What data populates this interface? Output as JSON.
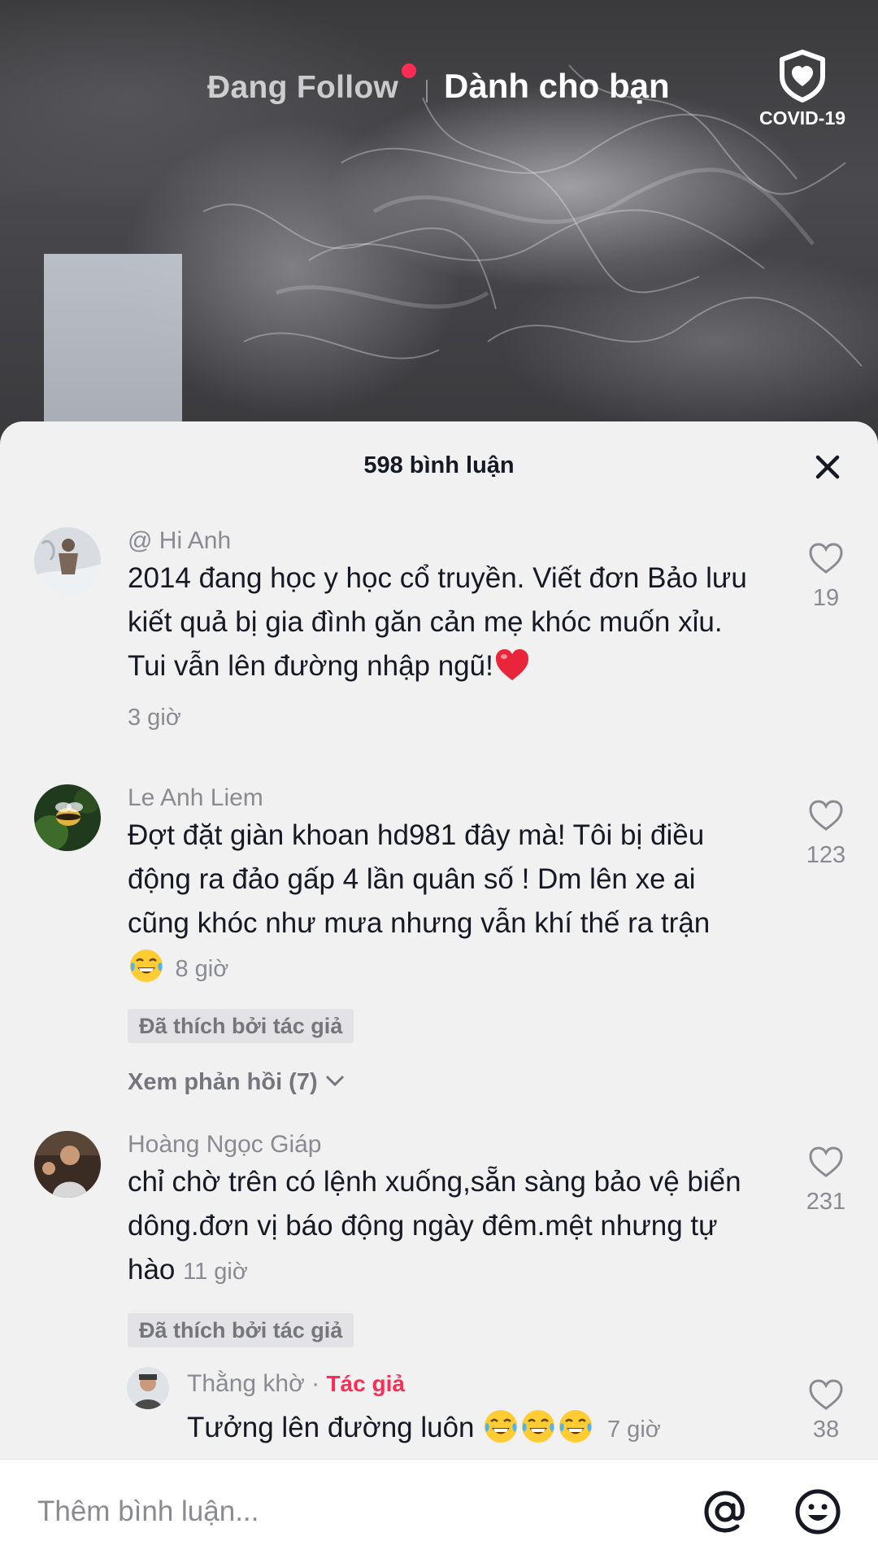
{
  "top_nav": {
    "following_label": "Đang Follow",
    "for_you_label": "Dành cho bạn",
    "covid_label": "COVID-19",
    "covid_icon": "shield-heart-icon",
    "notification_dot_color": "#fe2c55"
  },
  "comments_panel": {
    "title": "598 bình luận",
    "close_icon": "close-icon",
    "comments": [
      {
        "username": "@ Hi Anh",
        "text": "2014 đang học y học cổ truyền. Viết đơn Bảo lưu kiết quả bị gia đình găn cản mẹ khóc muốn xỉu. Tui vẫn lên đường nhập ngũ!",
        "emoji": "red-heart",
        "time": "3 giờ",
        "likes": "19"
      },
      {
        "username": "Le Anh Liem",
        "text": "Đợt đặt giàn khoan hd981 đây mà! Tôi bị điều động ra đảo gấp 4 lần quân số ! Dm lên xe ai cũng khóc như mưa nhưng vẫn khí thế ra trận",
        "emoji": "tears-of-joy",
        "time": "8 giờ",
        "likes": "123",
        "liked_by_author": "Đã thích bởi tác giả",
        "view_replies": "Xem phản hồi (7)"
      },
      {
        "username": "Hoàng Ngọc Giáp",
        "text": "chỉ chờ trên có lệnh xuống,sẵn sàng bảo vệ biển dông.đơn vị báo động ngày đêm.mệt nhưng tự hào",
        "time": "11 giờ",
        "likes": "231",
        "liked_by_author": "Đã thích bởi tác giả"
      }
    ],
    "reply": {
      "username": "Thằng khờ",
      "separator": "·",
      "author_tag": "Tác giả",
      "text": "Tưởng lên đường luôn",
      "emoji": "tears-of-joy",
      "time": "7 giờ",
      "likes": "38"
    }
  },
  "input_bar": {
    "placeholder": "Thêm bình luận...",
    "mention_icon": "at-sign-icon",
    "emoji_icon": "smiley-icon"
  },
  "colors": {
    "accent": "#fe2c55",
    "sheet_bg": "#f1f1f2",
    "muted_text": "#8a8b91",
    "primary_text": "#161823"
  }
}
